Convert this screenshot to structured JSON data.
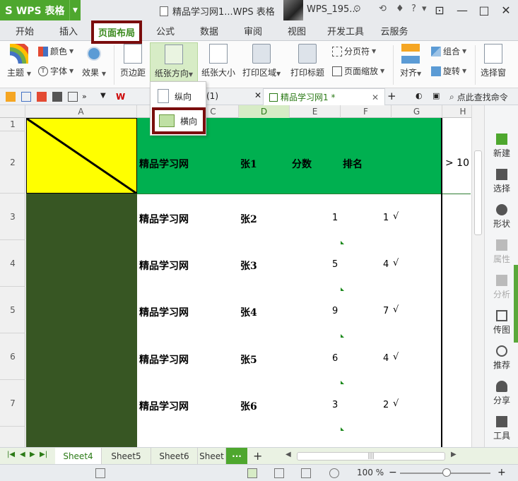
{
  "app": {
    "logo": "S",
    "name": "WPS 表格",
    "document_title": "精品学习网1...WPS 表格",
    "user_name": "WPS_195..."
  },
  "menu": {
    "tabs": [
      {
        "label": "开始"
      },
      {
        "label": "插入"
      },
      {
        "label": "页面布局",
        "active": true
      },
      {
        "label": "公式"
      },
      {
        "label": "数据"
      },
      {
        "label": "审阅"
      },
      {
        "label": "视图"
      },
      {
        "label": "开发工具"
      },
      {
        "label": "云服务"
      }
    ]
  },
  "ribbon": {
    "color": "颜色",
    "font": "字体",
    "theme": "主题",
    "effect": "效果",
    "margins": "页边距",
    "orientation": "纸张方向",
    "paper_size": "纸张大小",
    "print_area": "打印区域",
    "print_titles": "打印标题",
    "page_break": "分页符",
    "page_scale": "页面缩放",
    "align": "对齐",
    "group": "组合",
    "rotate": "旋转",
    "selection_pane": "选择窗"
  },
  "orientation_menu": {
    "portrait": "纵向",
    "landscape": "横向"
  },
  "doc_tabs": {
    "partial_tab": "(1)",
    "active_tab": "精品学习网1 *",
    "search": "点此查找命令"
  },
  "sheet": {
    "columns": [
      "A",
      "C",
      "D",
      "E",
      "F",
      "G",
      "H"
    ],
    "rows": [
      "1",
      "2",
      "3",
      "4",
      "5",
      "6",
      "7"
    ],
    "header_row": {
      "b": "精品学习网",
      "c": "张1",
      "d": "分数",
      "e": "排名",
      "h": "> 10"
    },
    "data_rows": [
      {
        "b": "精品学习网",
        "c": "张2",
        "e": "1",
        "f": "1",
        "check": "√"
      },
      {
        "b": "精品学习网",
        "c": "张3",
        "e": "5",
        "f": "4",
        "check": "√"
      },
      {
        "b": "精品学习网",
        "c": "张4",
        "e": "9",
        "f": "7",
        "check": "√"
      },
      {
        "b": "精品学习网",
        "c": "张5",
        "e": "6",
        "f": "4",
        "check": "√"
      },
      {
        "b": "精品学习网",
        "c": "张6",
        "e": "3",
        "f": "2",
        "check": "√"
      }
    ]
  },
  "right_panel": {
    "items": [
      {
        "label": "新建"
      },
      {
        "label": "选择"
      },
      {
        "label": "形状"
      },
      {
        "label": "属性"
      },
      {
        "label": "分析"
      },
      {
        "label": "传图"
      },
      {
        "label": "推荐"
      },
      {
        "label": "分享"
      },
      {
        "label": "工具"
      }
    ]
  },
  "sheet_tabs": {
    "tabs": [
      "Sheet4",
      "Sheet5",
      "Sheet6",
      "Sheet"
    ],
    "more": "···",
    "add": "+"
  },
  "status": {
    "zoom": "100 %"
  },
  "colors": {
    "brand_green": "#4ea72e",
    "highlight_border": "#7a0d0d",
    "header_fill": "#00b050",
    "yellow_fill": "#ffff00",
    "dark_green_fill": "#375623"
  }
}
